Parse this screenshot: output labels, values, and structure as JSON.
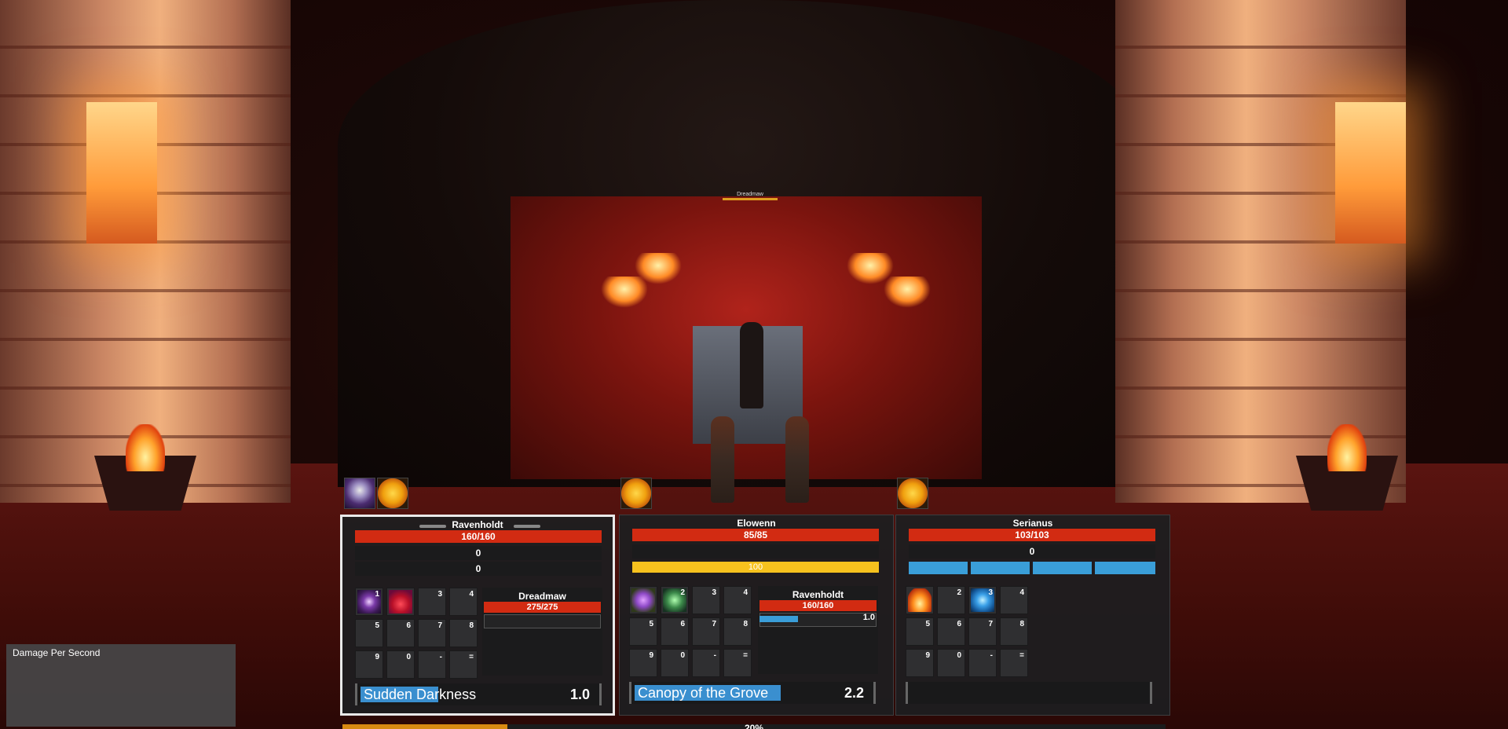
{
  "scene": {
    "boss_nameplate": "Dreadmaw",
    "boss_health": 1.0
  },
  "buffs": {
    "ravenholdt": [
      "skull-debuff-icon",
      "sun-buff-icon"
    ],
    "elowenn": [
      "sun-buff-icon"
    ],
    "serianus": [
      "sun-buff-icon"
    ]
  },
  "frames": [
    {
      "name": "Ravenholdt",
      "hp": "160/160",
      "res1": "0",
      "res2": "0",
      "slot_keys": [
        "1",
        "",
        "3",
        "4",
        "5",
        "6",
        "7",
        "8",
        "9",
        "0",
        "-",
        "="
      ],
      "icons": [
        "eye-ability-icon",
        "blood-drop-ability-icon"
      ],
      "target": {
        "name": "Dreadmaw",
        "hp": "275/275",
        "cast_value": ""
      },
      "cast": {
        "spell": "Sudden Darkness",
        "time": "1.0",
        "progress": 0.33
      }
    },
    {
      "name": "Elowenn",
      "hp": "85/85",
      "energy": "100",
      "slot_keys": [
        "",
        "2",
        "3",
        "4",
        "5",
        "6",
        "7",
        "8",
        "9",
        "0",
        "-",
        "="
      ],
      "icons": [
        "purple-flower-ability-icon",
        "leaf-ability-icon"
      ],
      "target": {
        "name": "Ravenholdt",
        "hp": "160/160",
        "cast_value": "1.0",
        "cast_progress": 0.33
      },
      "cast": {
        "spell": "Canopy of the Grove",
        "time": "2.2",
        "progress": 0.62
      }
    },
    {
      "name": "Serianus",
      "hp": "103/103",
      "res1": "0",
      "mana_segments": 4,
      "slot_keys": [
        "",
        "2",
        "3",
        "4",
        "5",
        "6",
        "7",
        "8",
        "9",
        "0",
        "-",
        "="
      ],
      "icons": [
        "fire-ability-icon",
        "frost-orb-ability-icon"
      ]
    }
  ],
  "dps_panel": {
    "title": "Damage Per Second"
  },
  "bottom_progress": {
    "label": "20%",
    "value": 0.2
  },
  "colors": {
    "health": "#d22b12",
    "energy": "#f7c21e",
    "mana": "#3a9ed8",
    "cast": "#3a8fcf"
  }
}
